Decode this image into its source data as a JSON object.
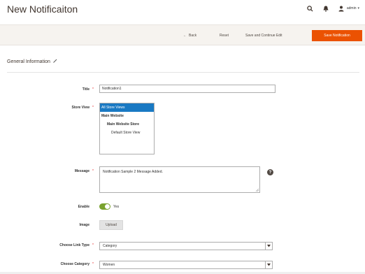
{
  "header": {
    "title": "New Notificaiton",
    "user_label": "admin",
    "icons": [
      "search-icon",
      "bell-icon",
      "user-icon",
      "chevron-down-icon"
    ]
  },
  "actions": {
    "back_label": "Back",
    "reset_label": "Reset",
    "save_continue_label": "Save and Continue Edit",
    "save_label": "Save Notification"
  },
  "section": {
    "title": "General Information"
  },
  "form": {
    "title": {
      "label": "Title",
      "value": "Notification1"
    },
    "store_view": {
      "label": "Store View",
      "options": [
        {
          "text": "All Store Views",
          "selected": true,
          "level": "selected"
        },
        {
          "text": "Main Website",
          "selected": false,
          "level": "lvl0"
        },
        {
          "text": "Main Website Store",
          "selected": false,
          "level": "lvl1"
        },
        {
          "text": "Default Store View",
          "selected": false,
          "level": "lvl2"
        }
      ]
    },
    "message": {
      "label": "Message",
      "value": "Notification Sample 2 Message Added.",
      "help_icon": "?"
    },
    "enable": {
      "label": "Enable",
      "value": "Yes",
      "on": true
    },
    "image": {
      "label": "Image",
      "button_label": "Upload"
    },
    "link_type": {
      "label": "Choose Link Type",
      "value": "Category"
    },
    "category": {
      "label": "Choose Category",
      "value": "Women"
    }
  },
  "colors": {
    "accent": "#eb5202",
    "selection": "#1979c3",
    "toggle_on": "#79a22e",
    "required": "#e22626"
  }
}
